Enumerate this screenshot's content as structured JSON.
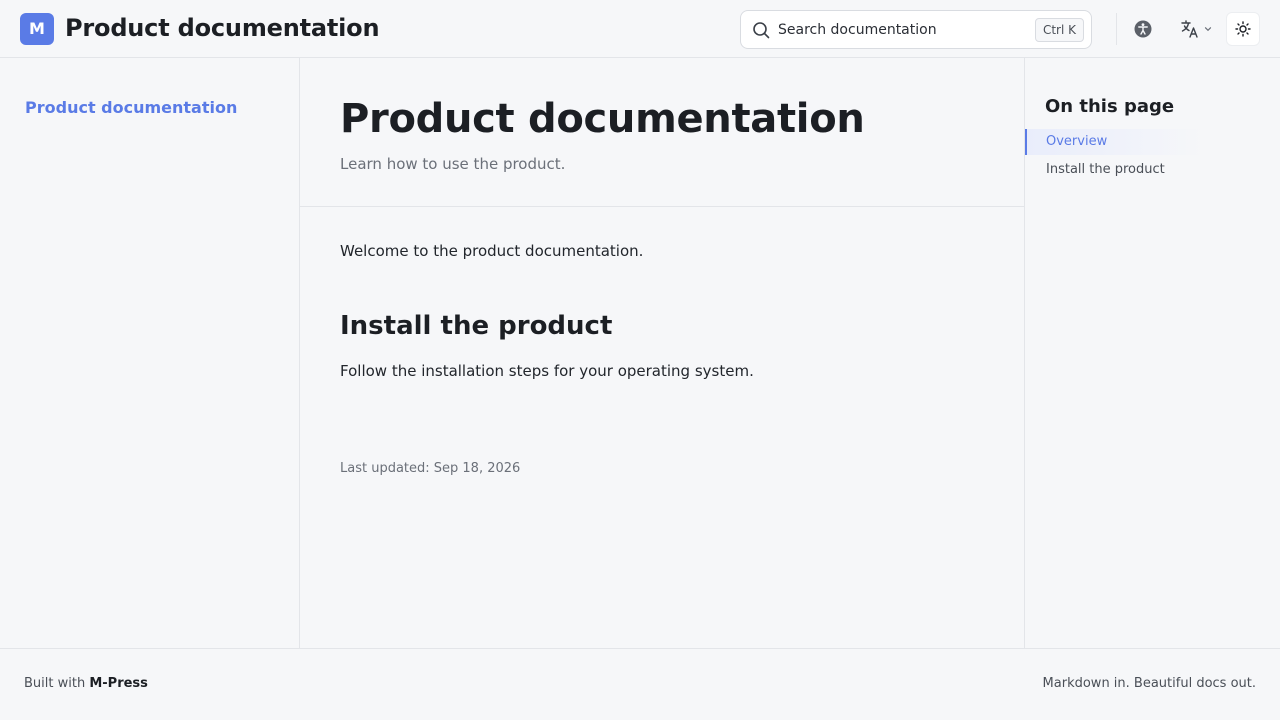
{
  "header": {
    "logo_letter": "M",
    "site_title": "Product documentation",
    "search": {
      "placeholder": "Search documentation",
      "shortcut": "Ctrl K"
    },
    "icons": {
      "accessibility": "accessibility-icon",
      "language": "translate-icon",
      "theme": "sun-icon"
    }
  },
  "sidebar": {
    "items": [
      {
        "label": "Product documentation",
        "active": true
      }
    ]
  },
  "main": {
    "title": "Product documentation",
    "description": "Learn how to use the product.",
    "intro": "Welcome to the product documentation.",
    "sections": [
      {
        "heading": "Install the product",
        "body": "Follow the installation steps for your operating system."
      }
    ],
    "last_updated": "Last updated: Sep 18, 2026"
  },
  "toc": {
    "title": "On this page",
    "items": [
      {
        "label": "Overview",
        "active": true
      },
      {
        "label": "Install the product",
        "active": false
      }
    ]
  },
  "footer": {
    "built_with_prefix": "Built with",
    "brand": "M-Press",
    "tagline": "Markdown in. Beautiful docs out."
  },
  "colors": {
    "accent": "#5a7be6",
    "background": "#f6f7f9",
    "border": "#e3e5e9"
  }
}
